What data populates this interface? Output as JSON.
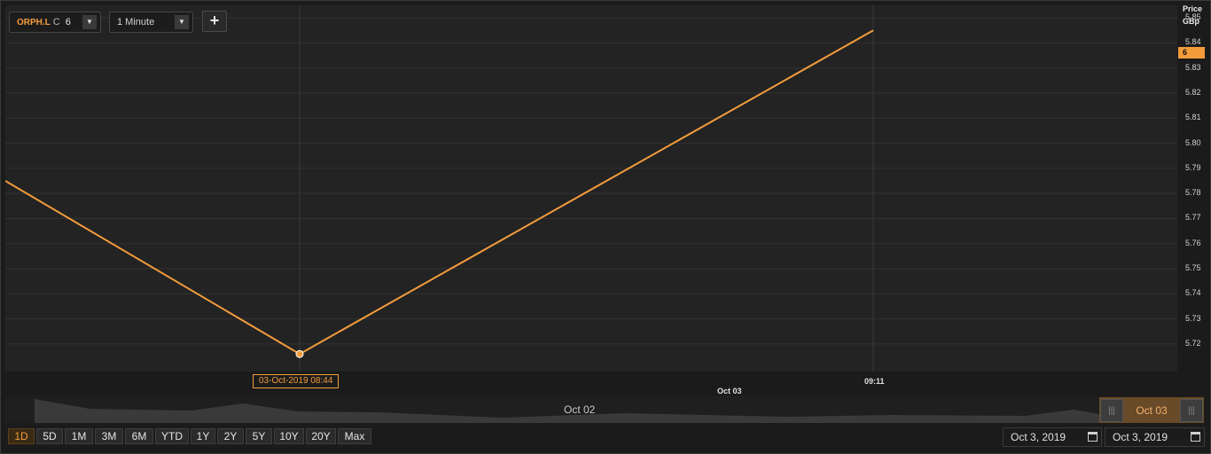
{
  "toolbar": {
    "symbol": "ORPH.L",
    "series_type": "C",
    "series_value": "6",
    "dropdown_glyph": "▼",
    "interval": "1 Minute",
    "add_glyph": "+"
  },
  "y_axis": {
    "title_line1": "Price",
    "title_line2": "GBp",
    "ticks": [
      "5.85",
      "5.84",
      "5.83",
      "5.82",
      "5.81",
      "5.80",
      "5.79",
      "5.78",
      "5.77",
      "5.76",
      "5.75",
      "5.74",
      "5.73",
      "5.72"
    ],
    "last_price_label": "6"
  },
  "x_axis": {
    "crosshair_label": "03-Oct-2019 08:44",
    "tick_time": "09:11",
    "tick_date": "Oct 03"
  },
  "chart_data": {
    "type": "line",
    "title": "",
    "xlabel": "",
    "ylabel": "Price GBp",
    "ylim": [
      5.709,
      5.855
    ],
    "x": [
      "before 08:44",
      "03-Oct-2019 08:44",
      "09:11"
    ],
    "series": [
      {
        "values": [
          5.785,
          5.716,
          5.845
        ],
        "color": "#f39c3c"
      }
    ],
    "highlighted_point": "03-Oct-2019 08:44",
    "grid": true
  },
  "navigator": {
    "label_left": "Oct 02",
    "label_window": "Oct 03",
    "handle_glyph": "|||"
  },
  "ranges": [
    "1D",
    "5D",
    "1M",
    "3M",
    "6M",
    "YTD",
    "1Y",
    "2Y",
    "5Y",
    "10Y",
    "20Y",
    "Max"
  ],
  "active_range": "1D",
  "date_range": {
    "from": "Oct 3, 2019",
    "to": "Oct 3, 2019"
  },
  "colors": {
    "accent": "#f39c3c",
    "background": "#1b1b1b",
    "plot": "#232323",
    "grid": "#333333"
  }
}
